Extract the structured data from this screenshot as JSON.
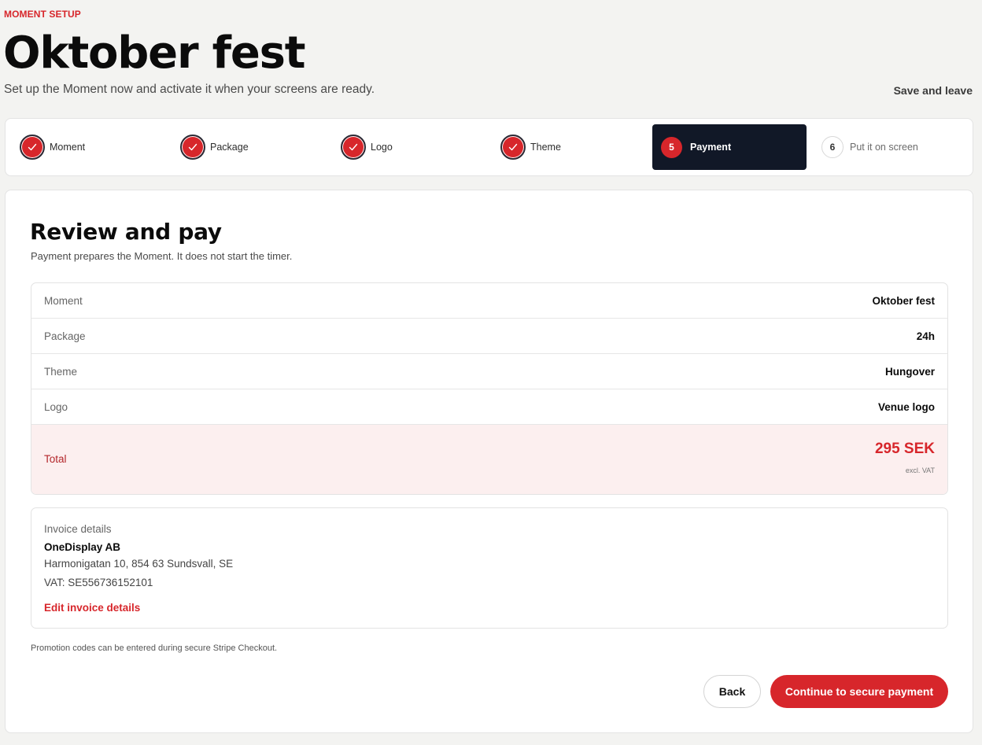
{
  "header": {
    "eyebrow": "MOMENT SETUP",
    "title": "Oktober fest",
    "subtitle": "Set up the Moment now and activate it when your screens are ready.",
    "save_leave": "Save and leave"
  },
  "stepper": {
    "steps": [
      {
        "number": "1",
        "label": "Moment",
        "state": "done"
      },
      {
        "number": "2",
        "label": "Package",
        "state": "done"
      },
      {
        "number": "3",
        "label": "Logo",
        "state": "done"
      },
      {
        "number": "4",
        "label": "Theme",
        "state": "done"
      },
      {
        "number": "5",
        "label": "Payment",
        "state": "active"
      },
      {
        "number": "6",
        "label": "Put it on screen",
        "state": "todo"
      }
    ]
  },
  "review": {
    "title": "Review and pay",
    "subtitle": "Payment prepares the Moment. It does not start the timer.",
    "rows": [
      {
        "label": "Moment",
        "value": "Oktober fest"
      },
      {
        "label": "Package",
        "value": "24h"
      },
      {
        "label": "Theme",
        "value": "Hungover"
      },
      {
        "label": "Logo",
        "value": "Venue logo"
      }
    ],
    "total": {
      "label": "Total",
      "amount": "295 SEK",
      "note": "excl. VAT"
    }
  },
  "invoice": {
    "heading": "Invoice details",
    "company": "OneDisplay AB",
    "address": "Harmonigatan 10, 854 63 Sundsvall, SE",
    "vat": "VAT: SE556736152101",
    "edit_label": "Edit invoice details"
  },
  "promo_note": "Promotion codes can be entered during secure Stripe Checkout.",
  "actions": {
    "back_label": "Back",
    "pay_label": "Continue to secure payment"
  },
  "colors": {
    "accent": "#d7262b",
    "active_step_bg": "#111827",
    "total_bg": "#fcefef",
    "page_bg": "#f3f3f1"
  }
}
